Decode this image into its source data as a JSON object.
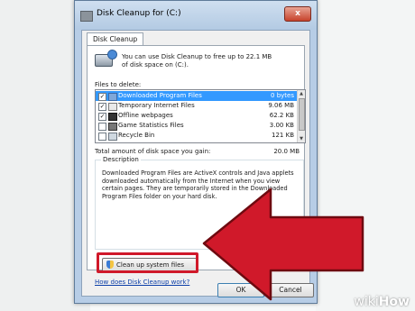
{
  "window": {
    "title": "Disk Cleanup for  (C:)",
    "close_label": "x"
  },
  "tab": "Disk Cleanup",
  "intro": "You can use Disk Cleanup to free up to 22.1 MB of disk space on  (C:).",
  "files_label": "Files to delete:",
  "files": [
    {
      "name": "Downloaded Program Files",
      "size": "0 bytes",
      "checked": true,
      "selected": true
    },
    {
      "name": "Temporary Internet Files",
      "size": "9.06 MB",
      "checked": true,
      "selected": false
    },
    {
      "name": "Offline webpages",
      "size": "62.2 KB",
      "checked": true,
      "selected": false
    },
    {
      "name": "Game Statistics Files",
      "size": "3.00 KB",
      "checked": false,
      "selected": false
    },
    {
      "name": "Recycle Bin",
      "size": "121 KB",
      "checked": false,
      "selected": false
    }
  ],
  "total_label": "Total amount of disk space you gain:",
  "total_value": "20.0 MB",
  "description": {
    "title": "Description",
    "text": "Downloaded Program Files are ActiveX controls and Java applets downloaded automatically from the Internet when you view certain pages. They are temporarily stored in the Downloaded Program Files folder on your hard disk."
  },
  "cleanup_button": "Clean up system files",
  "help_link": "How does Disk Cleanup work?",
  "ok_label": "OK",
  "cancel_label": "Cancel",
  "watermark": {
    "pre": "wiki",
    "post": "How"
  },
  "colors": {
    "highlight": "#d0192a",
    "selection": "#3399ff"
  }
}
